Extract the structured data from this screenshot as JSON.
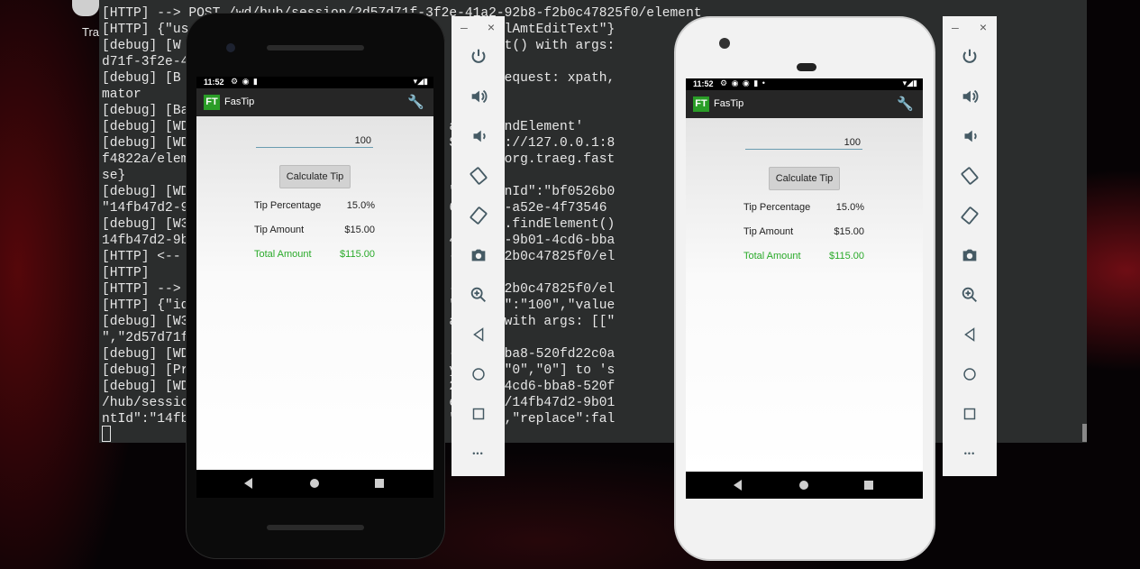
{
  "desktop": {
    "trash_label": "Trash"
  },
  "terminal": {
    "lines": [
      "[HTTP] --> POST /wd/hub/session/2d57d71f-3f2e-41a2-92b8-f2b0c47825f0/element",
      "[HTTP] {\"us                                     billAmtEditText\"}",
      "[debug] [W                                   Element() with args:                       ext\",\"2d57",
      "d71f-3f2e-4",
      "[debug] [B                                   this request: xpath,                       oid uiauto",
      "mator",
      "[debug] [Ba                                  ion",
      "[debug] [WD                                 ame 'findElement'",
      "[debug] [WD                                 ST http://127.0.0.1:8                       45c-9ae958",
      "f4822a/elem                                  tor\":\"org.traeg.fast                      iple\":fal",
      "se}",
      "[debug] [WD                                 \"sessionId\":\"bf0526b0                     a \"ELEMENT\":",
      "\"14fb47d2-9                                 66-11e4-a52e-4f73546                        0a04\"}}",
      "[debug] [W3                                  driver.findElement()                       6cecf\":\"",
      "14fb47d2-9b                                 4fb47d2-9b01-4cd6-bba",
      "[HTTP] <--                                  -92b8-f2b0c47825f0/el",
      "[HTTP]",
      "[HTTP] -->                                  -92b8-f2b0c47825f0/el                       0a04/value",
      "[HTTP] {\"id                                 \",\"text\":\"100\",\"value",
      "[debug] [W3                                 alue() with args: [[\"                      0fd22c0a04",
      "\",\"2d57d71f",
      "[debug] [WD                                 -4cd6-bba8-520fd22c0a",
      "[debug] [Pr                                 y [\"1\",\"0\",\"0\"] to 's",
      "[debug] [WD                                 2-9b01-4cd6-bba8-520f                       1:8201/wd",
      "/hub/sessio                                 element/14fb47d2-9b01                       v: {\"eleme",
      "ntId\":\"14fb                                 \":\"100\",\"replace\":fal"
    ]
  },
  "emulator1": {
    "status_time": "11:52",
    "app_title": "FasTip",
    "logo_text": "FT",
    "bill_amount": "100",
    "calculate_label": "Calculate Tip",
    "tip_percentage_label": "Tip Percentage",
    "tip_percentage_value": "15.0%",
    "tip_amount_label": "Tip Amount",
    "tip_amount_value": "$15.00",
    "total_amount_label": "Total Amount",
    "total_amount_value": "$115.00"
  },
  "emulator2": {
    "status_time": "11:52",
    "app_title": "FasTip",
    "logo_text": "FT",
    "bill_amount": "100",
    "calculate_label": "Calculate Tip",
    "tip_percentage_label": "Tip Percentage",
    "tip_percentage_value": "15.0%",
    "tip_amount_label": "Tip Amount",
    "tip_amount_value": "$15.00",
    "total_amount_label": "Total Amount",
    "total_amount_value": "$115.00"
  },
  "toolbar": {
    "minimize_glyph": "–",
    "close_glyph": "×",
    "more_glyph": "•••",
    "buttons": [
      "power-icon",
      "volume-up-icon",
      "volume-down-icon",
      "rotate-left-icon",
      "rotate-right-icon",
      "camera-icon",
      "zoom-icon",
      "back-icon",
      "home-icon",
      "overview-icon",
      "more-icon"
    ]
  },
  "colors": {
    "accent_green": "#2aaa2a",
    "logo_green": "#2a9d27",
    "app_bar": "#262626",
    "terminal_bg": "#2b2d2d"
  }
}
